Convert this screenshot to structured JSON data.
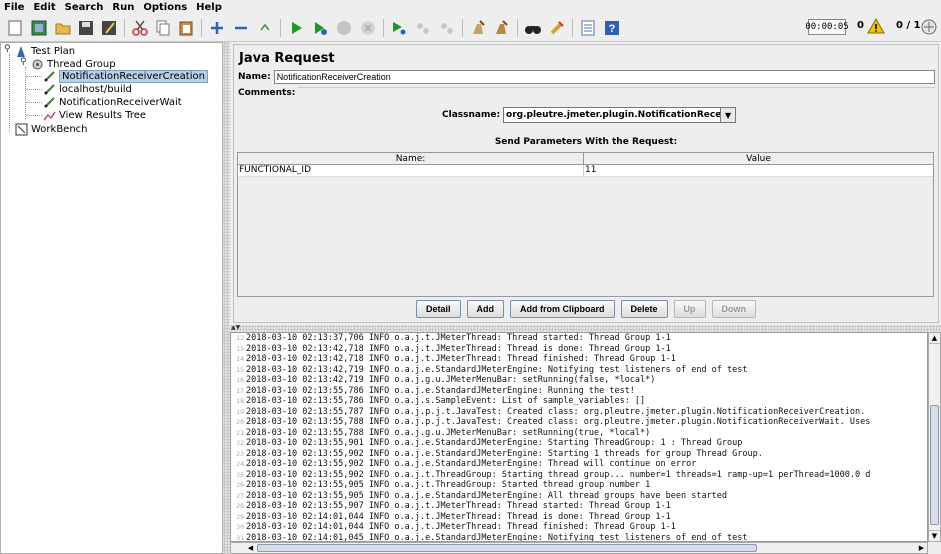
{
  "menu": [
    "File",
    "Edit",
    "Search",
    "Run",
    "Options",
    "Help"
  ],
  "toolbar": {
    "icons": [
      "new-icon",
      "templates-icon",
      "open-icon",
      "save-icon",
      "save-as-icon",
      "cut-icon",
      "copy-icon",
      "paste-icon",
      "expand-icon",
      "collapse-icon",
      "toggle-icon",
      "start-icon",
      "start-no-pause-icon",
      "stop-icon",
      "shutdown-icon",
      "remote-start-icon",
      "remote-stop-icon",
      "remote-shutdown-icon",
      "clear-icon",
      "clear-all-icon",
      "search-icon",
      "reset-search-icon",
      "function-helper-icon",
      "help-icon"
    ]
  },
  "status": {
    "elapsed": "00:00:05",
    "errors": "0",
    "threads": "0 / 1"
  },
  "tree": {
    "test_plan": "Test Plan",
    "thread_group": "Thread Group",
    "items": [
      "NotificationReceiverCreation",
      "localhost/build",
      "NotificationReceiverWait",
      "View Results Tree"
    ],
    "workbench": "WorkBench"
  },
  "panel": {
    "title": "Java Request",
    "name_label": "Name:",
    "name_value": "NotificationReceiverCreation",
    "comments_label": "Comments:",
    "classname_label": "Classname:",
    "classname_value": "org.pleutre.jmeter.plugin.NotificationReceiverCreation",
    "params_title": "Send Parameters With the Request:",
    "col_name": "Name:",
    "col_value": "Value",
    "rows": [
      {
        "name": "FUNCTIONAL_ID",
        "value": "11"
      }
    ],
    "buttons": {
      "detail": "Detail",
      "add": "Add",
      "add_clipboard": "Add from Clipboard",
      "delete": "Delete",
      "up": "Up",
      "down": "Down"
    }
  },
  "log": [
    {
      "n": "12",
      "t": "2018-03-10 02:13:37,706 INFO o.a.j.t.JMeterThread: Thread started: Thread Group 1-1"
    },
    {
      "n": "13",
      "t": "2018-03-10 02:13:42,718 INFO o.a.j.t.JMeterThread: Thread is done: Thread Group 1-1"
    },
    {
      "n": "14",
      "t": "2018-03-10 02:13:42,718 INFO o.a.j.t.JMeterThread: Thread finished: Thread Group 1-1"
    },
    {
      "n": "15",
      "t": "2018-03-10 02:13:42,719 INFO o.a.j.e.StandardJMeterEngine: Notifying test listeners of end of test"
    },
    {
      "n": "16",
      "t": "2018-03-10 02:13:42,719 INFO o.a.j.g.u.JMeterMenuBar: setRunning(false, *local*)"
    },
    {
      "n": "17",
      "t": "2018-03-10 02:13:55,786 INFO o.a.j.e.StandardJMeterEngine: Running the test!"
    },
    {
      "n": "18",
      "t": "2018-03-10 02:13:55,786 INFO o.a.j.s.SampleEvent: List of sample_variables: []"
    },
    {
      "n": "19",
      "t": "2018-03-10 02:13:55,787 INFO o.a.j.p.j.t.JavaTest: Created class: org.pleutre.jmeter.plugin.NotificationReceiverCreation."
    },
    {
      "n": "20",
      "t": "2018-03-10 02:13:55,788 INFO o.a.j.p.j.t.JavaTest: Created class: org.pleutre.jmeter.plugin.NotificationReceiverWait. Uses"
    },
    {
      "n": "21",
      "t": "2018-03-10 02:13:55,788 INFO o.a.j.g.u.JMeterMenuBar: setRunning(true, *local*)"
    },
    {
      "n": "22",
      "t": "2018-03-10 02:13:55,901 INFO o.a.j.e.StandardJMeterEngine: Starting ThreadGroup: 1 : Thread Group"
    },
    {
      "n": "23",
      "t": "2018-03-10 02:13:55,902 INFO o.a.j.e.StandardJMeterEngine: Starting 1 threads for group Thread Group."
    },
    {
      "n": "24",
      "t": "2018-03-10 02:13:55,902 INFO o.a.j.e.StandardJMeterEngine: Thread will continue on error"
    },
    {
      "n": "25",
      "t": "2018-03-10 02:13:55,902 INFO o.a.j.t.ThreadGroup: Starting thread group... number=1 threads=1 ramp-up=1 perThread=1000.0 d"
    },
    {
      "n": "26",
      "t": "2018-03-10 02:13:55,905 INFO o.a.j.t.ThreadGroup: Started thread group number 1"
    },
    {
      "n": "27",
      "t": "2018-03-10 02:13:55,905 INFO o.a.j.e.StandardJMeterEngine: All thread groups have been started"
    },
    {
      "n": "28",
      "t": "2018-03-10 02:13:55,907 INFO o.a.j.t.JMeterThread: Thread started: Thread Group 1-1"
    },
    {
      "n": "29",
      "t": "2018-03-10 02:14:01,044 INFO o.a.j.t.JMeterThread: Thread is done: Thread Group 1-1"
    },
    {
      "n": "30",
      "t": "2018-03-10 02:14:01,044 INFO o.a.j.t.JMeterThread: Thread finished: Thread Group 1-1"
    },
    {
      "n": "31",
      "t": "2018-03-10 02:14:01,045 INFO o.a.j.e.StandardJMeterEngine: Notifying test listeners of end of test"
    }
  ]
}
